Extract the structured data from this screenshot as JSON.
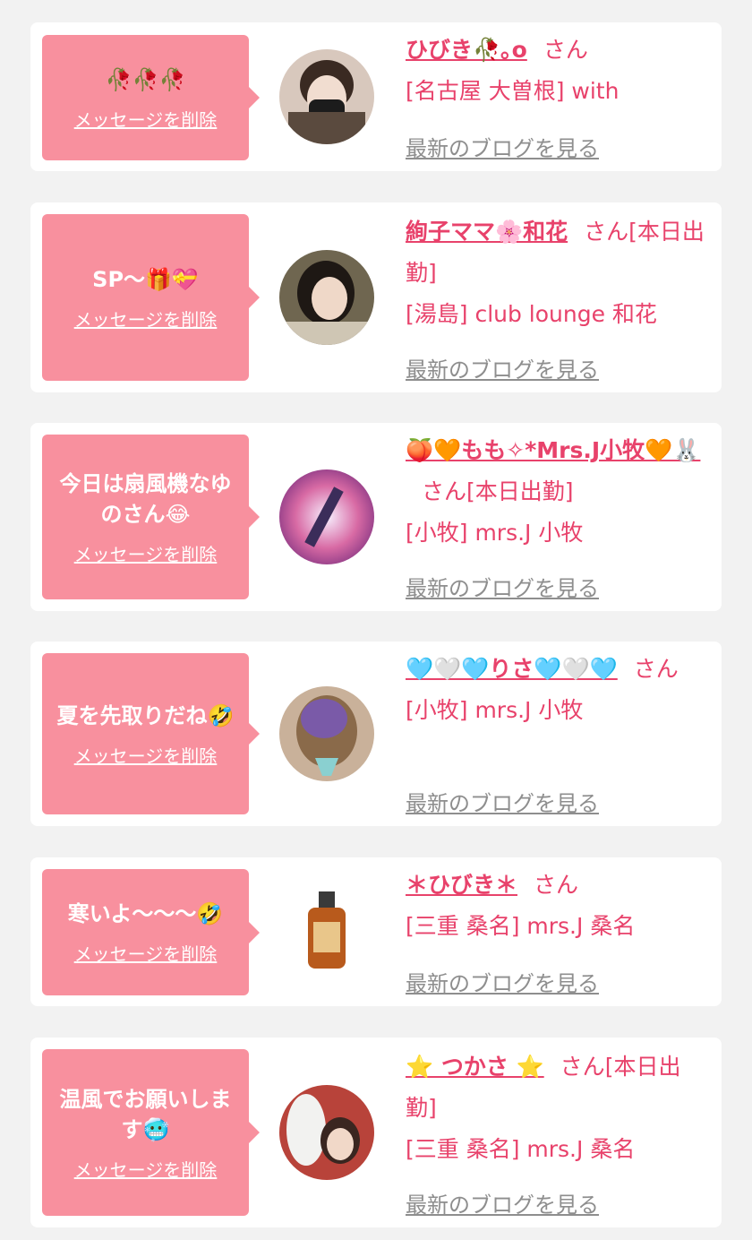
{
  "colors": {
    "accent": "#e8426b",
    "bubble": "#f8909e",
    "link_gray": "#8e8e8e",
    "bg": "#f2f2f2"
  },
  "delete_label": "メッセージを削除",
  "blog_label": "最新のブログを見る",
  "entries": [
    {
      "message": "🥀🥀🥀",
      "name": "ひびき🥀｡o",
      "honorific": "さん",
      "status": "",
      "shop": "[名古屋 大曽根] with"
    },
    {
      "message": "SP〜🎁💝",
      "name": "絢子ママ🌸和花",
      "honorific": "さん",
      "status": "[本日出勤]",
      "shop": "[湯島] club lounge 和花"
    },
    {
      "message": "今日は扇風機なゆのさん😂",
      "name": "🍑🧡もも✧*Mrs.J小牧🧡🐰",
      "honorific": "さん",
      "status": "[本日出勤]",
      "shop": "[小牧] mrs.J 小牧"
    },
    {
      "message": "夏を先取りだね🤣",
      "name": "🩵🤍🩵りさ🩵🤍🩵",
      "honorific": "さん",
      "status": "",
      "shop": "[小牧] mrs.J 小牧"
    },
    {
      "message": "寒いよ〜〜〜🤣",
      "name": "＊ひびき＊",
      "honorific": "さん",
      "status": "",
      "shop": "[三重 桑名] mrs.J 桑名"
    },
    {
      "message": "温風でお願いします🥶",
      "name": "⭐ つかさ ⭐",
      "honorific": "さん",
      "status": "[本日出勤]",
      "shop": "[三重 桑名] mrs.J 桑名"
    }
  ]
}
